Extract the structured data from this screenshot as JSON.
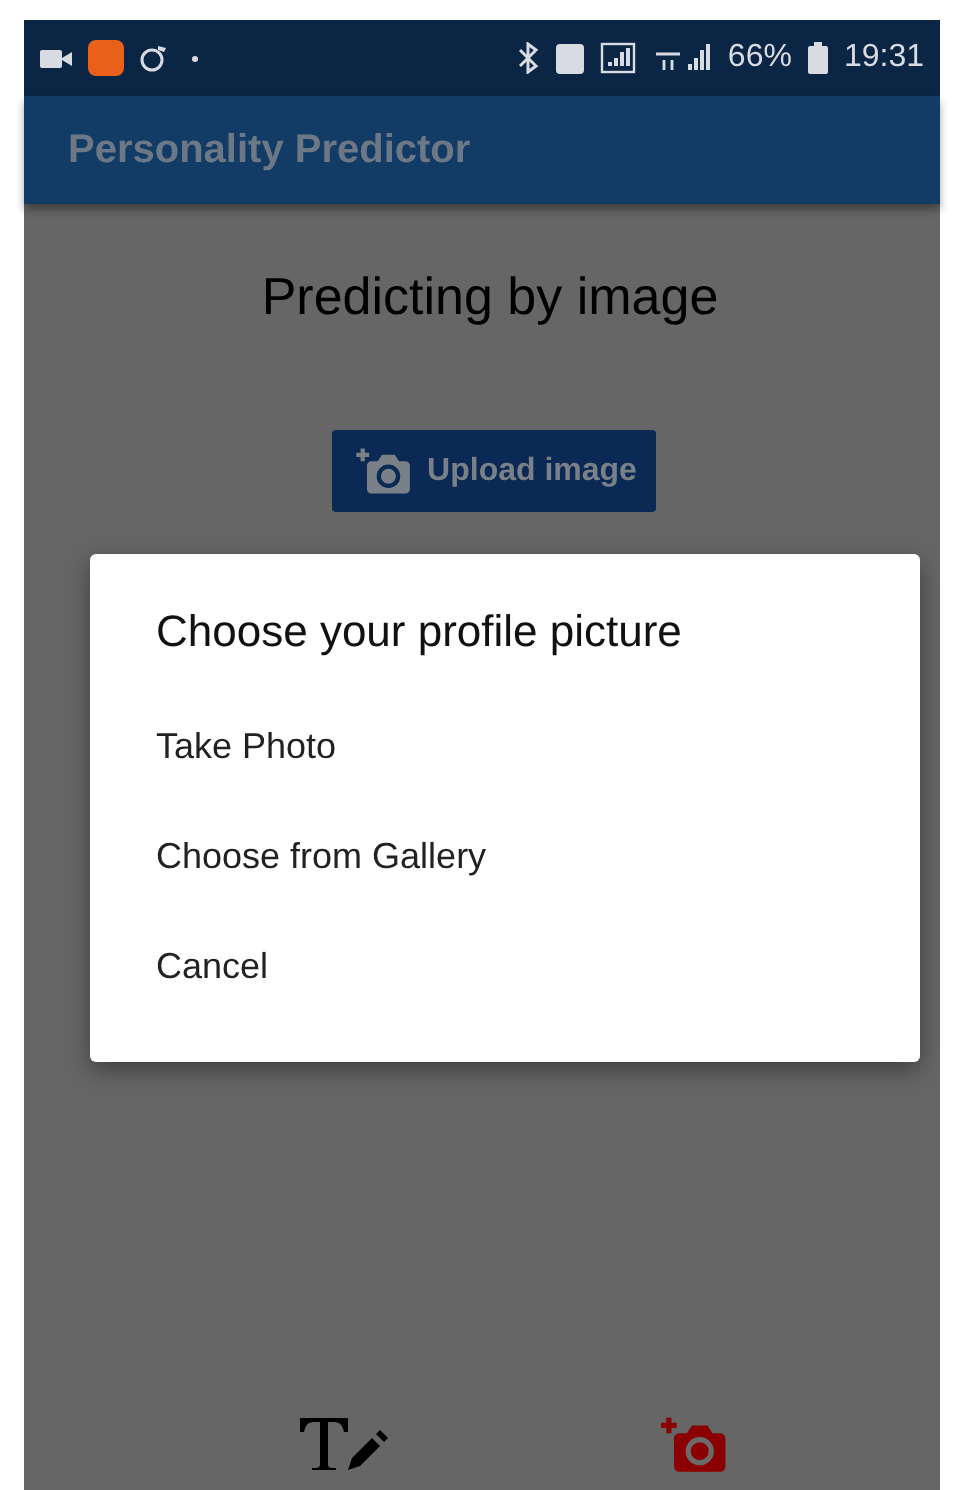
{
  "status_bar": {
    "battery": "66%",
    "time": "19:31"
  },
  "app_bar": {
    "title": "Personality Predictor"
  },
  "heading": "Predicting by image",
  "upload_button": {
    "label": "Upload image"
  },
  "dialog": {
    "title": "Choose your profile picture",
    "options": [
      "Take Photo",
      "Choose from Gallery",
      "Cancel"
    ]
  },
  "bottom_nav": [
    {
      "kind": "text",
      "selected": false
    },
    {
      "kind": "camera",
      "selected": true
    }
  ]
}
